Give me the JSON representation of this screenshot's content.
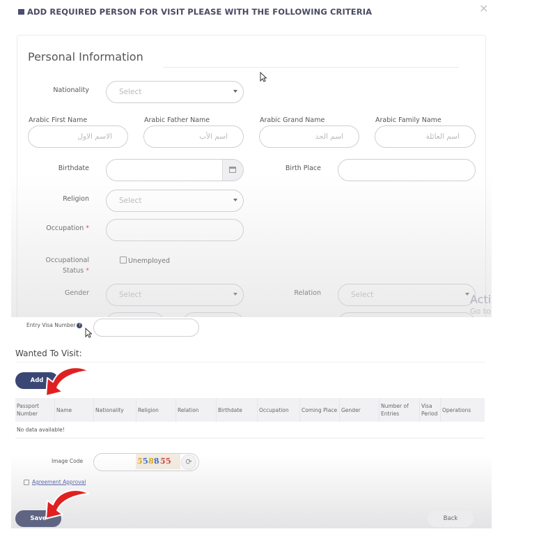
{
  "modal": {
    "title": "ADD REQUIRED PERSON FOR VISIT PLEASE WITH THE FOLLOWING CRITERIA",
    "close_icon": "×"
  },
  "personal_info": {
    "title": "Personal Information",
    "nationality": {
      "label": "Nationality",
      "value": "Select"
    },
    "arabic_first_name": {
      "label": "Arabic First Name",
      "placeholder": "الاسم الاول"
    },
    "arabic_father_name": {
      "label": "Arabic Father Name",
      "placeholder": "اسم الأب"
    },
    "arabic_grand_name": {
      "label": "Arabic Grand Name",
      "placeholder": "اسم الجد"
    },
    "arabic_family_name": {
      "label": "Arabic Family Name",
      "placeholder": "اسم العائلة"
    },
    "birthdate": {
      "label": "Birthdate",
      "icon": "calendar-icon"
    },
    "birth_place": {
      "label": "Birth Place"
    },
    "religion": {
      "label": "Religion",
      "value": "Select"
    },
    "occupation": {
      "label": "Occupation",
      "required": "*"
    },
    "occupational_status": {
      "label_line1": "Occupational",
      "label_line2": "Status",
      "required": "*",
      "option": "Unemployed"
    },
    "gender": {
      "label": "Gender",
      "value": "Select"
    },
    "relation": {
      "label": "Relation",
      "value": "Select"
    },
    "activate_windows": {
      "line1": "Activ",
      "line2": "Go to"
    }
  },
  "visa": {
    "entry_visa_label": "Entry Visa Number",
    "info_icon": "?"
  },
  "wanted": {
    "title": "Wanted To Visit:",
    "add_button": "Add",
    "table": {
      "headers": [
        "Passport Number",
        "Name",
        "Nationality",
        "Religion",
        "Relation",
        "Birthdate",
        "Occupation",
        "Coming Place",
        "Gender",
        "Number of Entries",
        "Visa Period",
        "Operations"
      ],
      "empty_text": "No data available!"
    }
  },
  "captcha": {
    "label": "Image Code",
    "code_chars": [
      {
        "ch": "5",
        "color": "#d6a21e"
      },
      {
        "ch": "5",
        "color": "#3b66c4"
      },
      {
        "ch": "8",
        "color": "#d6a21e"
      },
      {
        "ch": "8",
        "color": "#3b66c4"
      },
      {
        "ch": "5",
        "color": "#c43b3b"
      },
      {
        "ch": "5",
        "color": "#c43b3b"
      }
    ],
    "refresh_icon": "⟳"
  },
  "agreement": {
    "label": "Agreement Approval"
  },
  "footer": {
    "save_label": "Save",
    "back_label": "Back"
  },
  "colors": {
    "primary": "#3a4673",
    "annotation_arrow": "#e02020",
    "required": "#e03b3b"
  }
}
